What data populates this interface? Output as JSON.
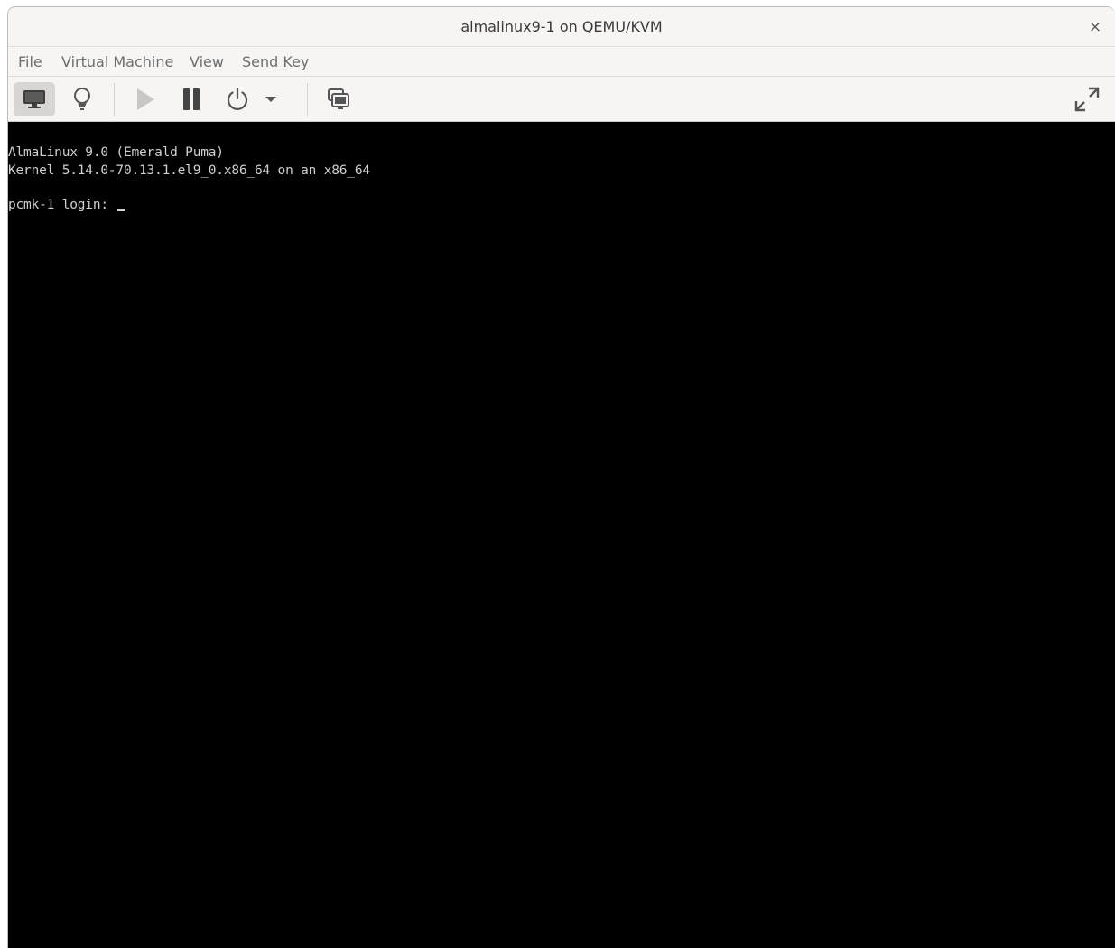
{
  "window": {
    "title": "almalinux9-1 on QEMU/KVM",
    "close_glyph": "×"
  },
  "menu": {
    "items": [
      {
        "label": "File"
      },
      {
        "label": "Virtual Machine"
      },
      {
        "label": "View"
      },
      {
        "label": "Send Key"
      }
    ]
  },
  "toolbar": {
    "icons": [
      "monitor-icon",
      "lightbulb-icon",
      "play-icon",
      "pause-icon",
      "power-icon",
      "dropdown-arrow-icon",
      "snapshots-icon",
      "fullscreen-icon"
    ],
    "active_button": "console-view"
  },
  "console": {
    "lines": [
      "AlmaLinux 9.0 (Emerald Puma)",
      "Kernel 5.14.0-70.13.1.el9_0.x86_64 on an x86_64",
      "",
      "pcmk-1 login: "
    ],
    "colors": {
      "background": "#000000",
      "text": "#cfcfcf"
    }
  }
}
